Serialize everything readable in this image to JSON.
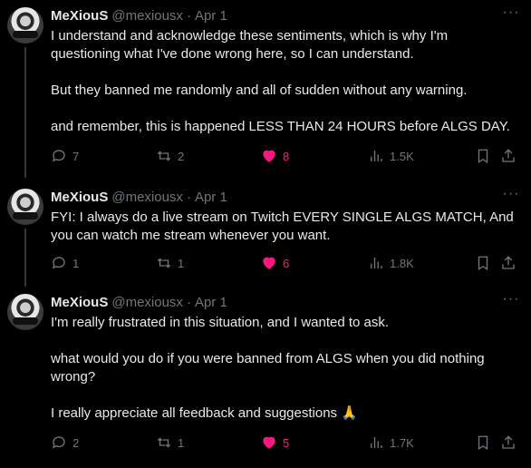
{
  "tweets": [
    {
      "name": "MeXiouS",
      "handle": "@mexiousx",
      "dot": "·",
      "date": "Apr 1",
      "paragraphs": [
        "I understand and acknowledge these sentiments, which is why I'm questioning what I've done wrong here, so I can understand.",
        "But they banned me randomly and all of sudden without any warning.",
        "and remember, this is happened LESS THAN 24 HOURS before ALGS DAY."
      ],
      "replies": "7",
      "reposts": "2",
      "likes": "8",
      "views": "1.5K"
    },
    {
      "name": "MeXiouS",
      "handle": "@mexiousx",
      "dot": "·",
      "date": "Apr 1",
      "paragraphs": [
        "FYI: I always do a live stream on Twitch EVERY SINGLE ALGS MATCH, And you can watch me stream whenever you want."
      ],
      "replies": "1",
      "reposts": "1",
      "likes": "6",
      "views": "1.8K"
    },
    {
      "name": "MeXiouS",
      "handle": "@mexiousx",
      "dot": "·",
      "date": "Apr 1",
      "paragraphs": [
        "I'm really frustrated in this situation, and I wanted to ask.",
        "what would you do if you were banned from ALGS when you did nothing wrong?",
        "I really appreciate all feedback and suggestions"
      ],
      "emoji": "🙏",
      "replies": "2",
      "reposts": "1",
      "likes": "5",
      "views": "1.7K"
    }
  ],
  "icons": {
    "reply": "speech-bubble-icon",
    "repost": "repost-arrows-icon",
    "like": "heart-icon",
    "views": "bar-chart-icon",
    "bookmark": "bookmark-icon",
    "share": "share-icon",
    "more": "more-dots-icon"
  },
  "colors": {
    "background": "#000000",
    "text": "#e7e9ea",
    "secondary": "#71767b",
    "like": "#f91880"
  }
}
